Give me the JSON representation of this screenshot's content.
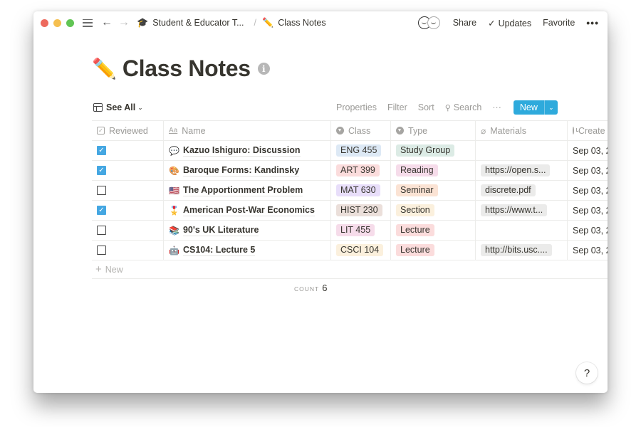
{
  "topbar": {
    "breadcrumbs": [
      {
        "emoji": "🎓",
        "label": "Student & Educator T..."
      },
      {
        "emoji": "✏️",
        "label": "Class Notes"
      }
    ],
    "separator": "/",
    "share_label": "Share",
    "updates_label": "Updates",
    "updates_check": "✓",
    "favorite_label": "Favorite",
    "more_label": "•••",
    "back_arrow": "←",
    "forward_arrow": "→"
  },
  "page": {
    "emoji": "✏️",
    "title": "Class Notes",
    "info_glyph": "i"
  },
  "view": {
    "name": "See All",
    "chevron": "⌄",
    "actions": {
      "properties": "Properties",
      "filter": "Filter",
      "sort": "Sort",
      "search": "Search",
      "search_icon": "⚲",
      "more": "···",
      "new": "New",
      "new_arrow": "⌄"
    }
  },
  "table": {
    "columns": [
      {
        "key": "reviewed",
        "label": "Reviewed",
        "icon": "checkbox-icon"
      },
      {
        "key": "name",
        "label": "Name",
        "icon": "text-icon"
      },
      {
        "key": "class",
        "label": "Class",
        "icon": "select-icon"
      },
      {
        "key": "type",
        "label": "Type",
        "icon": "select-icon"
      },
      {
        "key": "materials",
        "label": "Materials",
        "icon": "paperclip-icon"
      },
      {
        "key": "created",
        "label": "Create",
        "icon": "clock-icon"
      }
    ],
    "header_text_icon": "Aa",
    "header_check_glyph": "✓",
    "header_clip_glyph": "⌀",
    "rows": [
      {
        "reviewed": true,
        "emoji": "💬",
        "name": "Kazuo Ishiguro: Discussion",
        "class": "ENG 455",
        "class_color": "#dde9f5",
        "type": "Study Group",
        "type_color": "#dcebe5",
        "materials": "",
        "created": "Sep 03, 2"
      },
      {
        "reviewed": true,
        "emoji": "🎨",
        "name": "Baroque Forms: Kandinsky",
        "class": "ART 399",
        "class_color": "#fbdcdc",
        "type": "Reading",
        "type_color": "#f6dcea",
        "materials": "https://open.s...",
        "created": "Sep 03, 2"
      },
      {
        "reviewed": false,
        "emoji": "🇺🇸",
        "name": "The Apportionment Problem",
        "class": "MAT 630",
        "class_color": "#e8defa",
        "type": "Seminar",
        "type_color": "#fbe3d4",
        "materials": "discrete.pdf",
        "created": "Sep 03, 2"
      },
      {
        "reviewed": true,
        "emoji": "🎖️",
        "name": "American Post-War Economics",
        "class": "HIST 230",
        "class_color": "#ebdfda",
        "type": "Section",
        "type_color": "#fbf0dd",
        "materials": "https://www.t...",
        "created": "Sep 03, 2"
      },
      {
        "reviewed": false,
        "emoji": "📚",
        "name": "90's UK Literature",
        "class": "LIT 455",
        "class_color": "#f6dcea",
        "type": "Lecture",
        "type_color": "#fbdcdc",
        "materials": "",
        "created": "Sep 03, 2"
      },
      {
        "reviewed": false,
        "emoji": "🤖",
        "name": "CS104: Lecture 5",
        "class": "CSCI 104",
        "class_color": "#fbf0dd",
        "type": "Lecture",
        "type_color": "#fbdcdc",
        "materials": "http://bits.usc....",
        "created": "Sep 03, 2"
      }
    ],
    "add_row_label": "New",
    "add_row_plus": "+",
    "count_label": "COUNT",
    "count_value": "6"
  },
  "help": {
    "label": "?"
  },
  "colors": {
    "accent": "#2eaadc",
    "checkbox_on": "#45a7e2",
    "text": "#37352f",
    "muted": "#9b9a97"
  }
}
